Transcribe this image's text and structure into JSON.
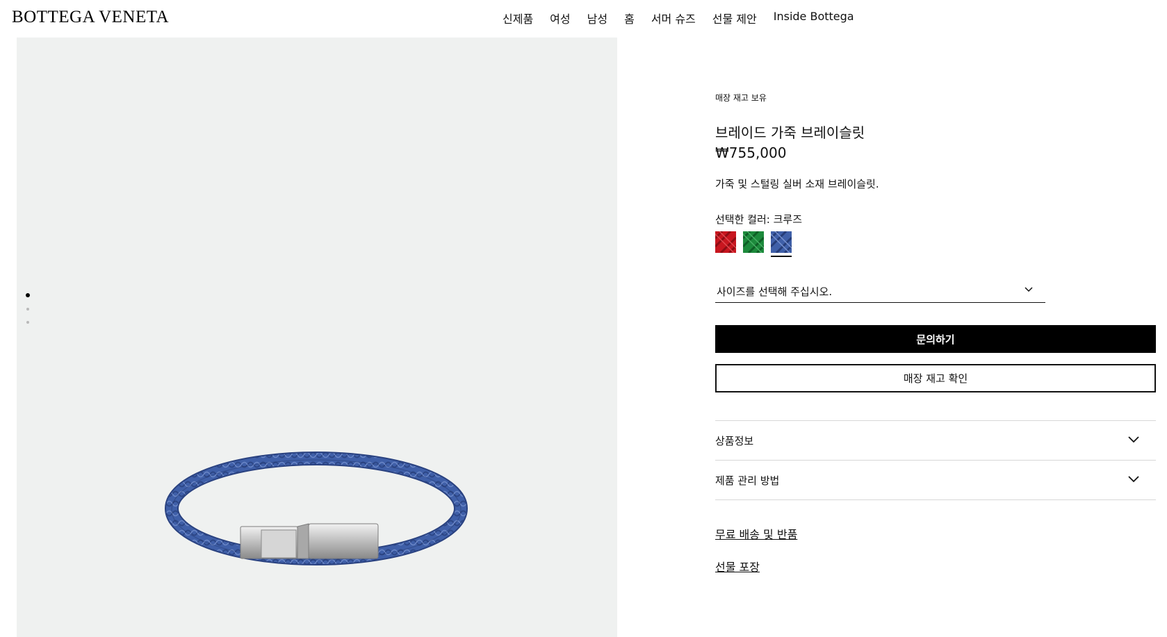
{
  "brand": {
    "logo": "BOTTEGA VENETA"
  },
  "nav": {
    "items": [
      {
        "label": "신제품"
      },
      {
        "label": "여성"
      },
      {
        "label": "남성"
      },
      {
        "label": "홈"
      },
      {
        "label": "서머 슈즈"
      },
      {
        "label": "선물 제안"
      },
      {
        "label": "Inside Bottega"
      }
    ]
  },
  "gallery": {
    "active_slide": 1,
    "slide_count": 3,
    "product_color": "#3f5fa8"
  },
  "product": {
    "stock_label": "매장 재고 보유",
    "title": "브레이드 가죽 브레이슬릿",
    "price": "₩755,000",
    "description": "가죽 및 스털링 실버 소재 브레이슬릿.",
    "color_label": "선택한 컬러: 크루즈",
    "swatches": [
      {
        "name": "red",
        "color": "#c8161f",
        "selected": false
      },
      {
        "name": "green",
        "color": "#1d8a3c",
        "selected": false
      },
      {
        "name": "cruise",
        "color": "#3f5fa8",
        "selected": true
      }
    ],
    "size_placeholder": "사이즈를 선택해 주십시오.",
    "primary_button": "문의하기",
    "secondary_button": "매장 재고 확인",
    "accordion": [
      {
        "label": "상품정보"
      },
      {
        "label": "제품 관리 방법"
      }
    ],
    "links": [
      {
        "label": "무료 배송 및 반품"
      },
      {
        "label": "선물 포장"
      }
    ]
  }
}
